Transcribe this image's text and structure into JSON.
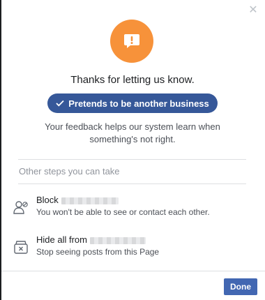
{
  "dialog": {
    "close_icon": "close-icon",
    "alert_icon": "speech-bubble-exclamation-icon",
    "thanks_text": "Thanks for letting us know.",
    "selected_reason": "Pretends to be another business",
    "feedback_text": "Your feedback helps our system learn when something's not right.",
    "steps_header": "Other steps you can take",
    "options": [
      {
        "icon": "block-person-icon",
        "title": "Block",
        "description": "You won't be able to see or contact each other."
      },
      {
        "icon": "hide-box-icon",
        "title": "Hide all from",
        "description": "Stop seeing posts from this Page"
      }
    ],
    "done_label": "Done"
  },
  "colors": {
    "accent_orange": "#f7923a",
    "pill_blue": "#365899",
    "button_blue": "#4267b2",
    "divider": "#dddfe2",
    "muted_text": "#90949c"
  }
}
